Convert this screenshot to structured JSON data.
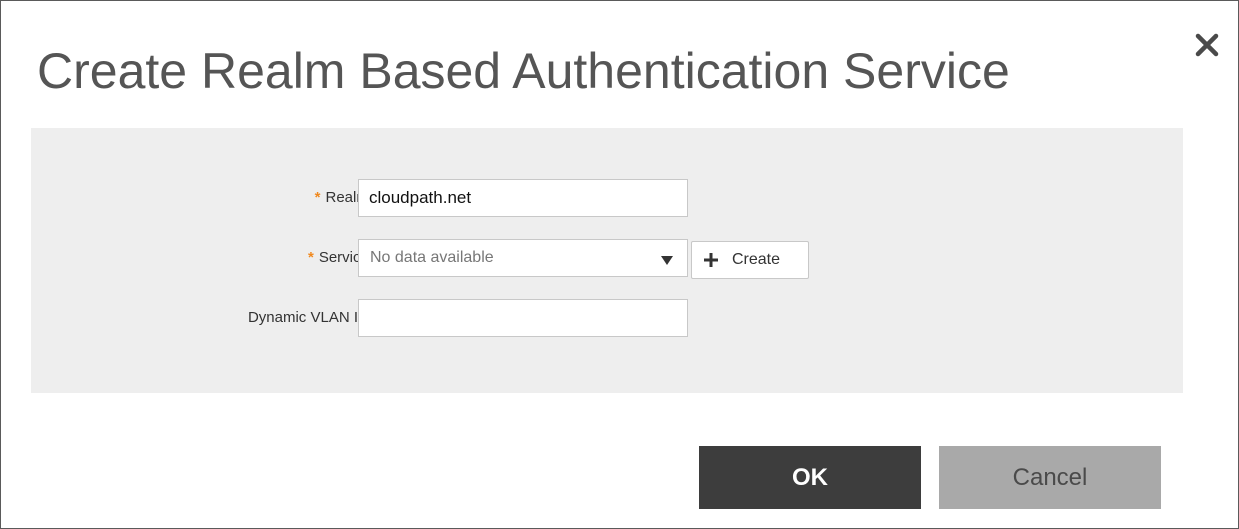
{
  "dialog": {
    "title": "Create Realm Based Authentication Service",
    "close_icon": "close-icon"
  },
  "form": {
    "realm": {
      "label": "Realm:",
      "required_mark": "*",
      "value": "cloudpath.net"
    },
    "service": {
      "label": "Service:",
      "required_mark": "*",
      "selected": "No data available",
      "dropdown_icon": "caret-down-icon",
      "create_label": "Create",
      "create_icon": "plus-icon"
    },
    "dynamic_vlan": {
      "label": "Dynamic VLAN ID:",
      "value": ""
    }
  },
  "actions": {
    "ok_label": "OK",
    "cancel_label": "Cancel"
  },
  "colors": {
    "required": "#f0891f",
    "ok_bg": "#3d3d3d",
    "cancel_bg": "#a9a9a9",
    "panel_bg": "#eeeeee",
    "title": "#555555"
  }
}
